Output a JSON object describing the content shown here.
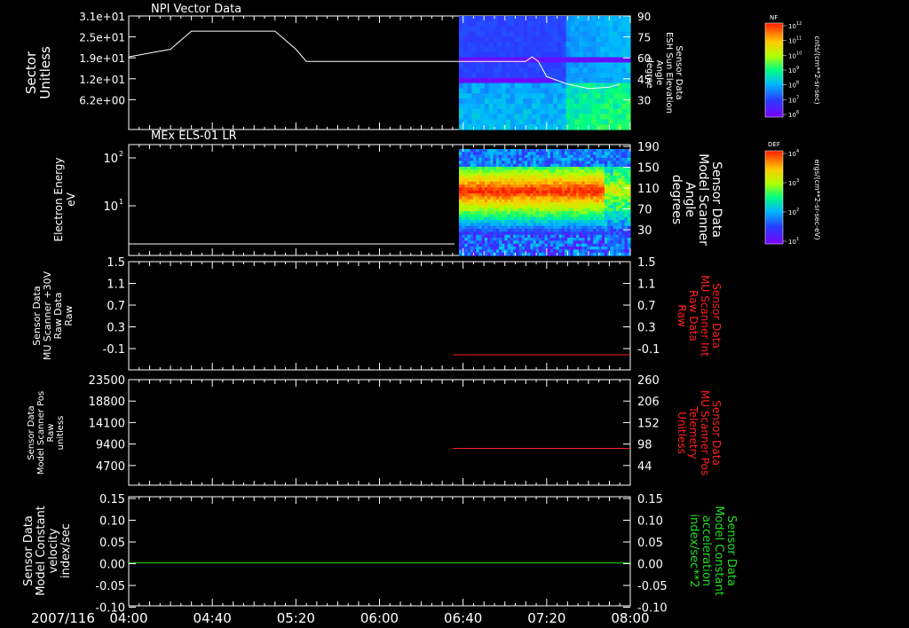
{
  "colors": {
    "background": "#000000",
    "axis": "#ffffff",
    "red_trace": "#ff2020",
    "green_trace": "#22dd22"
  },
  "chart_data": [
    {
      "type": "line",
      "title": "NPI Vector Data",
      "ylabel": [
        "Sector",
        "Unitless"
      ],
      "yticks": [
        "3.1e+01",
        "2.5e+01",
        "1.9e+01",
        "1.2e+01",
        "6.2e+00"
      ],
      "ylabel_right": [
        "Sensor Data",
        "ESH Sun Elevation",
        "Angle",
        "degree"
      ],
      "yticks_right": [
        "90",
        "75",
        "60",
        "45",
        "30"
      ],
      "ylim_right": [
        15,
        90
      ],
      "line_series": {
        "x": [
          "04:00",
          "04:20",
          "04:30",
          "04:40",
          "05:00",
          "05:10",
          "05:20",
          "05:25",
          "06:00",
          "06:40",
          "07:10",
          "07:13",
          "07:16",
          "07:20",
          "07:30",
          "07:40",
          "07:50",
          "07:55"
        ],
        "y": [
          63,
          68,
          80,
          80,
          80,
          80,
          68,
          60,
          60,
          60,
          60,
          63,
          60,
          50,
          45,
          42,
          43,
          45
        ]
      },
      "spectrogram": {
        "x_start": "06:38",
        "x_end": "08:00",
        "colorbar_label": "NF",
        "colorbar_units": "cnts/(cm**2-sr-sec)",
        "colorbar_ticks": [
          "10^12",
          "10^11",
          "10^10",
          "10^9",
          "10^8",
          "10^7",
          "10^6"
        ]
      }
    },
    {
      "type": "heatmap",
      "title": "MEx ELS-01 LR",
      "ylabel": [
        "Electron Energy",
        "eV"
      ],
      "yticks": [
        "10^2",
        "10^1"
      ],
      "ylabel_right": [
        "Sensor Data",
        "Model Scanner",
        "Angle",
        "degrees"
      ],
      "yticks_right": [
        "190",
        "150",
        "110",
        "70",
        "30"
      ],
      "ylim_right": [
        0,
        190
      ],
      "flat_line_value": 10,
      "spectrogram": {
        "x_start": "06:38",
        "x_end": "08:00",
        "colorbar_label": "DEF",
        "colorbar_units": "ergs/(cm**2-sr-sec-eV)",
        "colorbar_ticks": [
          "10^4",
          "10^3",
          "10^2",
          "10^1"
        ]
      }
    },
    {
      "type": "line",
      "title": "",
      "ylabel": [
        "Sensor Data",
        "MU Scanner +30V",
        "Raw Data",
        "Raw"
      ],
      "yticks": [
        "1.5",
        "1.1",
        "0.7",
        "0.3",
        "-0.1"
      ],
      "ylim": [
        -0.3,
        1.5
      ],
      "ylabel_right": [
        "Sensor Data",
        "MU Scanner Int",
        "Raw Data",
        "Raw"
      ],
      "yticks_right": [
        "1.5",
        "1.1",
        "0.7",
        "0.3",
        "-0.1"
      ],
      "series": [
        {
          "x_start": "06:35",
          "x_end": "08:00",
          "value": -0.05,
          "color": "#ff2020"
        }
      ]
    },
    {
      "type": "line",
      "title": "",
      "ylabel": [
        "Sensor Data",
        "Model Scanner Pos",
        "Raw",
        "unitless"
      ],
      "yticks": [
        "23500",
        "18800",
        "14100",
        "9400",
        "4700"
      ],
      "ylim": [
        0,
        23500
      ],
      "ylabel_right": [
        "Sensor Data",
        "MU Scanner Pos",
        "Telemetry",
        "Unitless"
      ],
      "yticks_right": [
        "260",
        "206",
        "152",
        "98",
        "44"
      ],
      "ylim_right": [
        0,
        260
      ],
      "series": [
        {
          "x_start": "06:35",
          "x_end": "08:00",
          "value": 8200,
          "color": "#ff2020"
        }
      ]
    },
    {
      "type": "line",
      "title": "",
      "ylabel": [
        "Sensor Data",
        "Model Constant",
        "velocity",
        "index/sec"
      ],
      "yticks": [
        "0.15",
        "0.10",
        "0.05",
        "0.00",
        "-0.05",
        "-0.10"
      ],
      "ylim": [
        -0.1,
        0.15
      ],
      "ylabel_right": [
        "Sensor Data",
        "Model Constant",
        "acceleration",
        "index/sec**2"
      ],
      "yticks_right": [
        "0.15",
        "0.10",
        "0.05",
        "0.00",
        "-0.05",
        "-0.10"
      ],
      "series": [
        {
          "x_start": "04:00",
          "x_end": "08:00",
          "value": 0.0,
          "color": "#22dd22"
        }
      ]
    }
  ],
  "time_axis": {
    "date": "2007/116",
    "ticks": [
      "04:00",
      "04:40",
      "05:20",
      "06:00",
      "06:40",
      "07:20",
      "08:00"
    ],
    "xlim": [
      "04:00",
      "08:00"
    ]
  }
}
